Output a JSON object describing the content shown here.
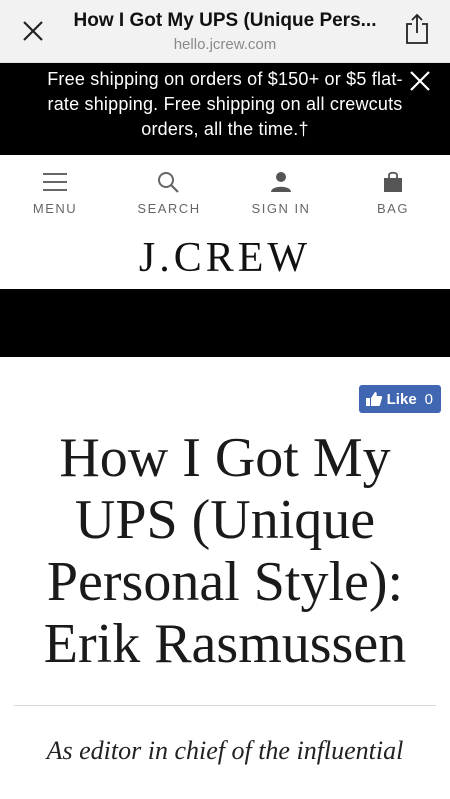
{
  "browser": {
    "title": "How I Got My UPS (Unique Pers...",
    "url": "hello.jcrew.com"
  },
  "promo": {
    "text": "Free shipping on orders of $150+ or $5 flat-rate shipping. Free shipping on all crewcuts orders, all the time.†"
  },
  "nav": {
    "menu": "MENU",
    "search": "SEARCH",
    "sign_in": "SIGN IN",
    "bag": "BAG"
  },
  "logo": "J.CREW",
  "like": {
    "label": "Like",
    "count": "0",
    "color": "#4267b2"
  },
  "article": {
    "headline": "How I Got My UPS (Unique Personal Style): Erik Rasmussen",
    "dek": "As editor in chief of the influential"
  },
  "icons": [
    "close-icon",
    "share-icon",
    "menu-icon",
    "search-icon",
    "user-icon",
    "bag-icon",
    "thumbs-up-icon"
  ]
}
